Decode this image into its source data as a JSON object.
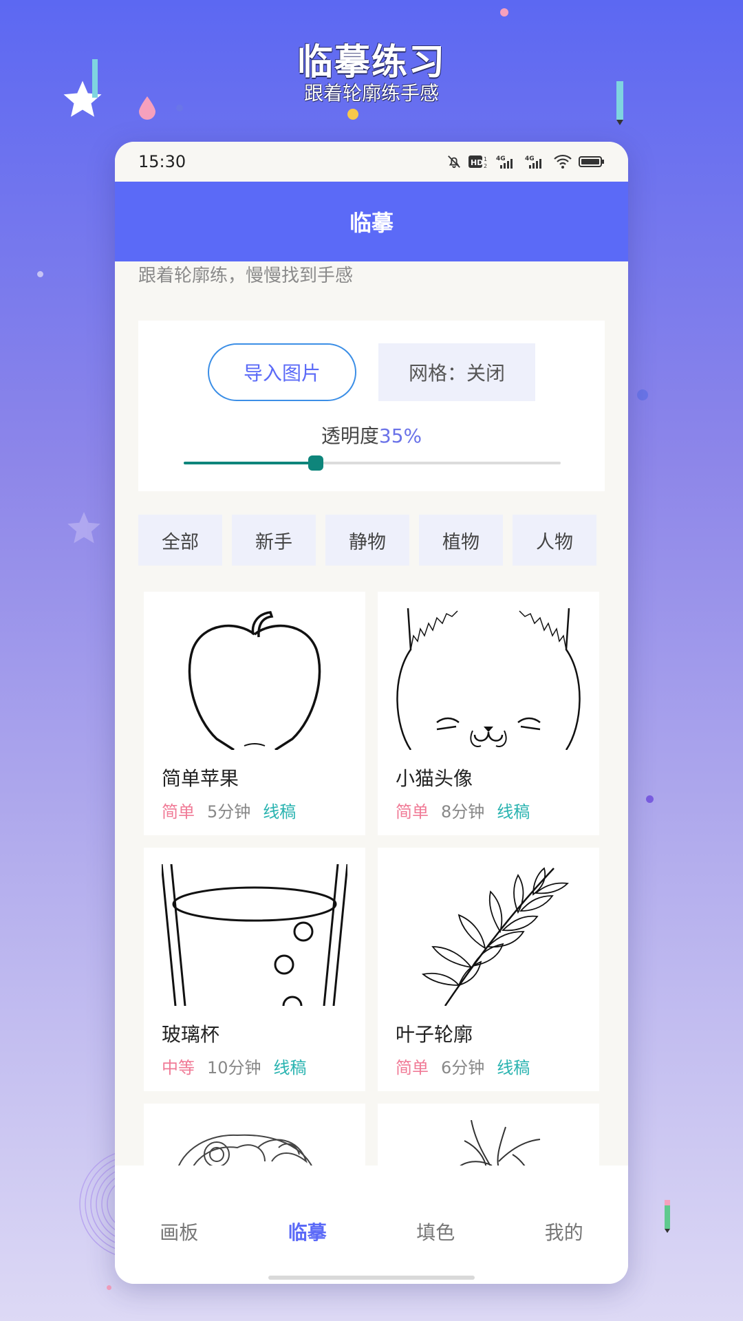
{
  "promo": {
    "title": "临摹练习",
    "subtitle": "跟着轮廓练手感"
  },
  "status_bar": {
    "time": "15:30",
    "icons": [
      "bell-off-icon",
      "hd-icon",
      "signal-4g-icon",
      "signal-4g-icon",
      "wifi-icon",
      "battery-icon"
    ]
  },
  "header": {
    "title": "临摹"
  },
  "intro": "跟着轮廓练，慢慢找到手感",
  "controls": {
    "import_label": "导入图片",
    "grid_label": "网格：关闭",
    "opacity_label": "透明度",
    "opacity_value": "35%",
    "opacity_fraction": 0.35
  },
  "categories": [
    "全部",
    "新手",
    "静物",
    "植物",
    "人物"
  ],
  "templates": [
    {
      "title": "简单苹果",
      "level": "简单",
      "time": "5分钟",
      "type": "线稿",
      "icon": "apple-sketch"
    },
    {
      "title": "小猫头像",
      "level": "简单",
      "time": "8分钟",
      "type": "线稿",
      "icon": "cat-sketch"
    },
    {
      "title": "玻璃杯",
      "level": "中等",
      "time": "10分钟",
      "type": "线稿",
      "icon": "glass-sketch"
    },
    {
      "title": "叶子轮廓",
      "level": "简单",
      "time": "6分钟",
      "type": "线稿",
      "icon": "leaf-sketch"
    }
  ],
  "nav": {
    "items": [
      "画板",
      "临摹",
      "填色",
      "我的"
    ],
    "active_index": 1
  },
  "colors": {
    "accent": "#5b6af7",
    "level": "#f07a96",
    "type": "#29b3b0",
    "slider": "#0e857b"
  }
}
